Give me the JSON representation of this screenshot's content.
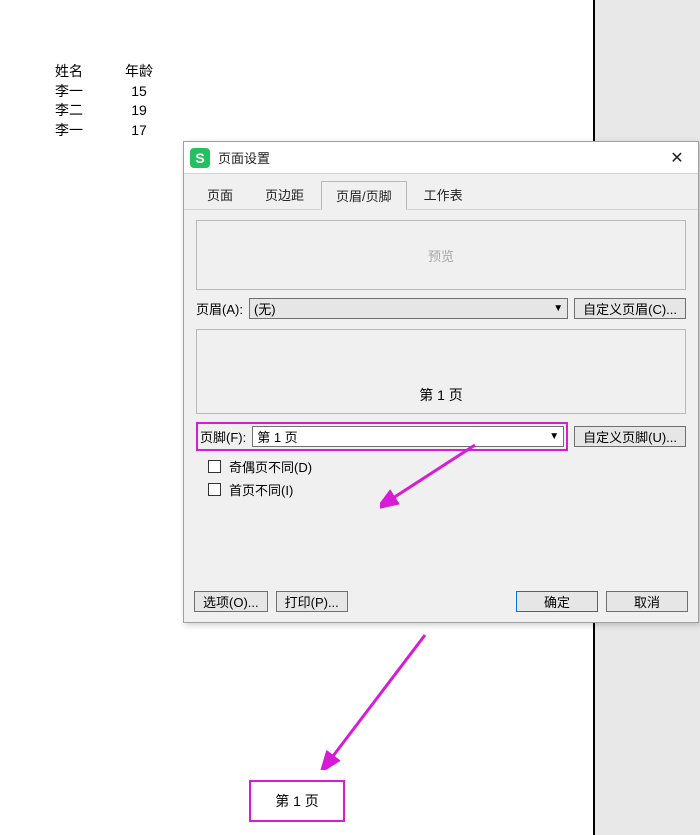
{
  "sheet": {
    "headers": [
      "姓名",
      "年龄"
    ],
    "rows": [
      [
        "李一",
        "15"
      ],
      [
        "李二",
        "19"
      ],
      [
        "李一",
        "17"
      ]
    ]
  },
  "dialog": {
    "title": "页面设置",
    "tabs": [
      "页面",
      "页边距",
      "页眉/页脚",
      "工作表"
    ],
    "activeTab": 2,
    "preview_label": "预览",
    "header": {
      "label": "页眉(A):",
      "value": "(无)",
      "custom_btn": "自定义页眉(C)..."
    },
    "footer_preview": "第 1 页",
    "footer": {
      "label": "页脚(F):",
      "value": "第 1 页",
      "custom_btn": "自定义页脚(U)..."
    },
    "checks": {
      "odd_even": "奇偶页不同(D)",
      "first_page": "首页不同(I)"
    },
    "btns": {
      "options": "选项(O)...",
      "print": "打印(P)...",
      "ok": "确定",
      "cancel": "取消"
    }
  },
  "page_footer_text": "第 1 页",
  "colors": {
    "highlight": "#d61cd6",
    "primary": "#0078d4",
    "brand": "#22c060"
  }
}
